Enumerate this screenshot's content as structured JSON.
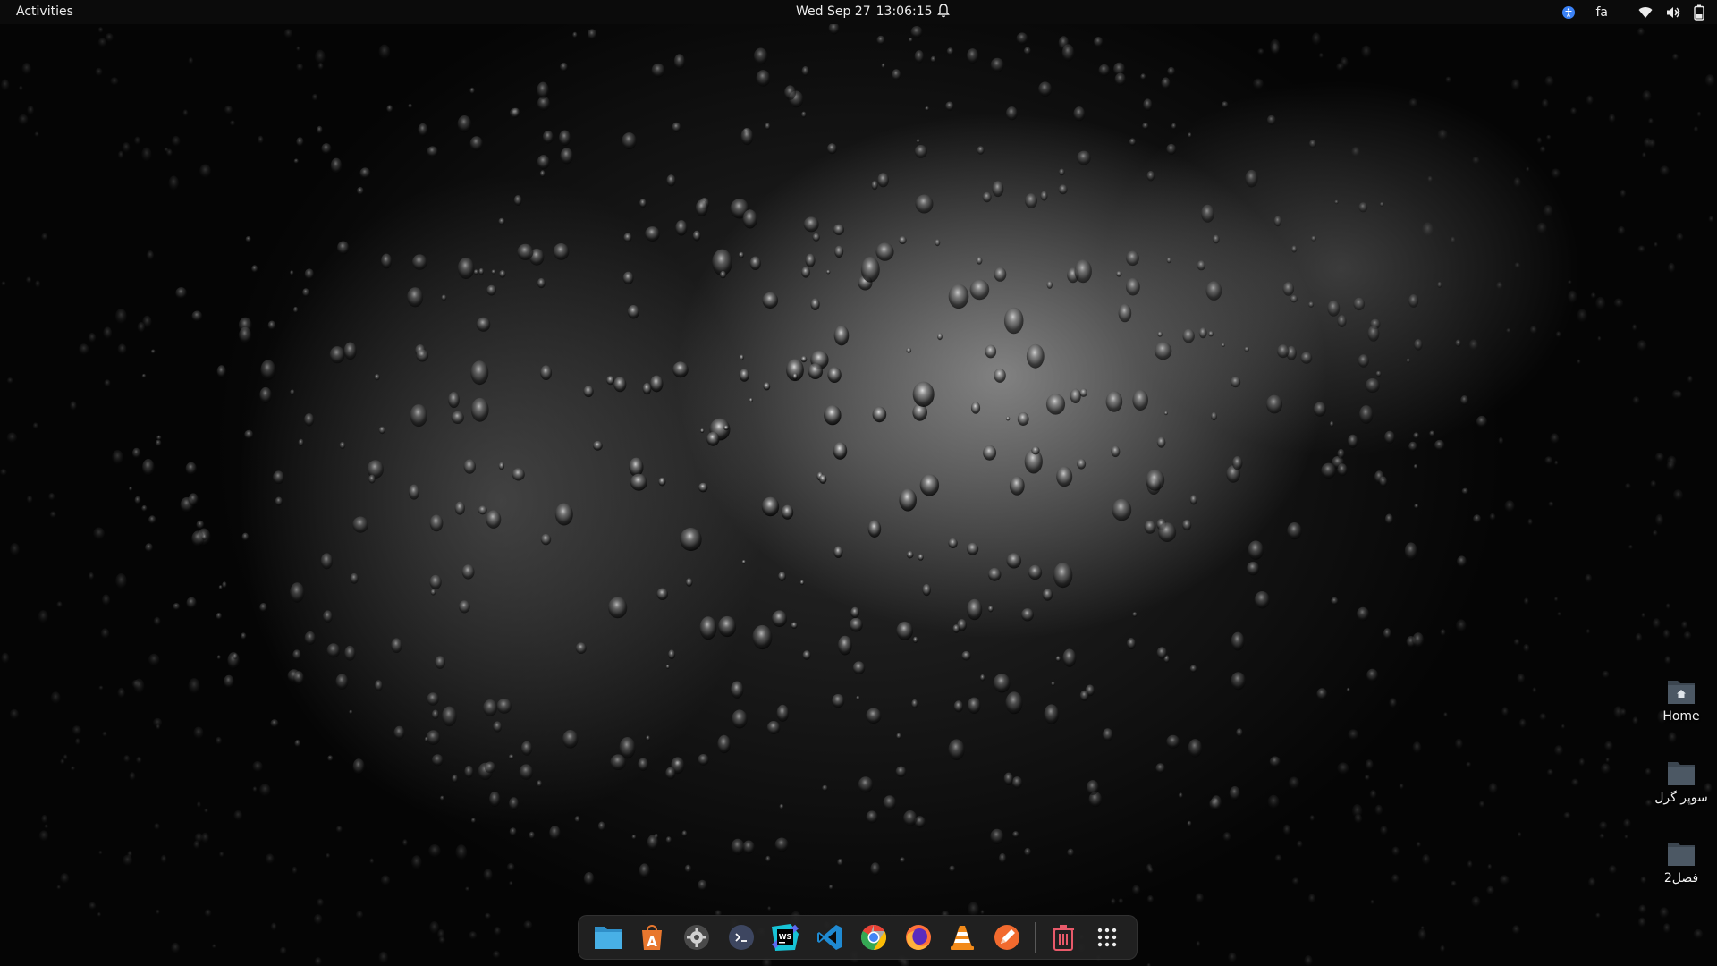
{
  "topbar": {
    "activities_label": "Activities",
    "date": "Wed Sep 27",
    "time": "13:06:15",
    "language": "fa",
    "icons": [
      "notification-bell-icon",
      "accessibility-icon",
      "wifi-icon",
      "volume-icon",
      "battery-icon"
    ]
  },
  "desktop_icons": [
    {
      "label": "Home",
      "icon": "home-folder-icon"
    },
    {
      "label": "سوپر گرل",
      "icon": "folder-icon"
    },
    {
      "label": "فصل2",
      "icon": "folder-icon"
    }
  ],
  "dock": {
    "apps": [
      {
        "name": "files",
        "icon": "files-icon"
      },
      {
        "name": "software-center",
        "icon": "app-store-icon"
      },
      {
        "name": "settings",
        "icon": "settings-gear-icon"
      },
      {
        "name": "terminal",
        "icon": "terminal-icon"
      },
      {
        "name": "webstorm",
        "icon": "webstorm-icon"
      },
      {
        "name": "vscode",
        "icon": "vscode-icon"
      },
      {
        "name": "chrome",
        "icon": "chrome-icon"
      },
      {
        "name": "firefox",
        "icon": "firefox-icon"
      },
      {
        "name": "vlc",
        "icon": "vlc-icon"
      },
      {
        "name": "drawing",
        "icon": "drawing-pen-icon"
      },
      {
        "name": "trash",
        "icon": "trash-icon"
      },
      {
        "name": "show-apps",
        "icon": "app-grid-icon"
      }
    ]
  },
  "colors": {
    "topbar_bg": "#0b0b0b",
    "dock_bg": "#232323",
    "folder": "#4a5560",
    "accent_blue": "#3b82f6"
  }
}
